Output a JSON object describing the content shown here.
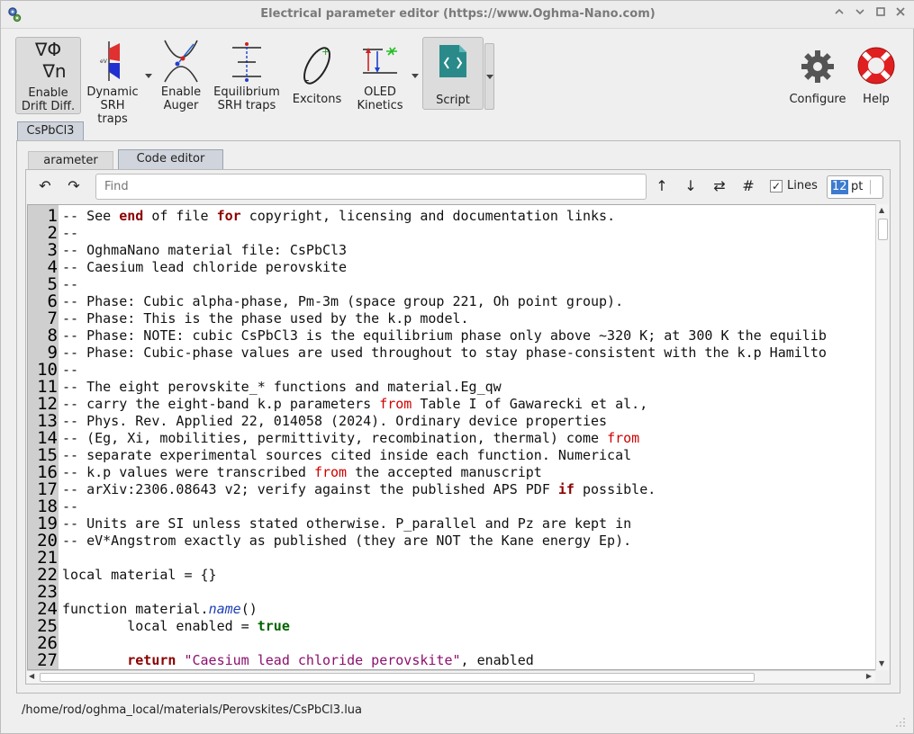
{
  "window": {
    "title": "Electrical parameter editor (https://www.Oghma-Nano.com)",
    "controls": [
      "minimize",
      "maximize",
      "restore",
      "close"
    ]
  },
  "toolbar": {
    "drift_diff_label1": "Enable",
    "drift_diff_label2": "Drift Diff.",
    "dynamic_srh_label1": "Dynamic",
    "dynamic_srh_label2": "SRH traps",
    "auger_label1": "Enable",
    "auger_label2": "Auger",
    "eq_srh_label1": "Equilibrium",
    "eq_srh_label2": "SRH traps",
    "excitons_label": "Excitons",
    "oled_label1": "OLED",
    "oled_label2": "Kinetics",
    "script_label": "Script",
    "configure_label": "Configure",
    "help_label": "Help",
    "drift_icon_line1": "∇Φ",
    "drift_icon_line2": "∇n"
  },
  "tabs": {
    "material": "CsPbCl3",
    "parameter": "arameter",
    "code_editor": "Code editor"
  },
  "editor_toolbar": {
    "undo": "↶",
    "redo": "↷",
    "find_placeholder": "Find",
    "up": "↑",
    "down": "↓",
    "replace": "⇄",
    "hash": "#",
    "lines_label": "Lines",
    "lines_checked": true,
    "font_size": "12",
    "font_unit": "pt"
  },
  "code": {
    "line_numbers": [
      "1",
      "2",
      "3",
      "4",
      "5",
      "6",
      "7",
      "8",
      "9",
      "10",
      "11",
      "12",
      "13",
      "14",
      "15",
      "16",
      "17",
      "18",
      "19",
      "20",
      "21",
      "22",
      "23",
      "24",
      "25",
      "26",
      "27"
    ],
    "lines": [
      "-- See end of file for copyright, licensing and documentation links.",
      "--",
      "-- OghmaNano material file: CsPbCl3",
      "-- Caesium lead chloride perovskite",
      "--",
      "-- Phase: Cubic alpha-phase, Pm-3m (space group 221, Oh point group).",
      "-- Phase: This is the phase used by the k.p model.",
      "-- Phase: NOTE: cubic CsPbCl3 is the equilibrium phase only above ~320 K; at 300 K the equilib",
      "-- Phase: Cubic-phase values are used throughout to stay phase-consistent with the k.p Hamilto",
      "--",
      "-- The eight perovskite_* functions and material.Eg_qw",
      "-- carry the eight-band k.p parameters from Table I of Gawarecki et al.,",
      "-- Phys. Rev. Applied 22, 014058 (2024). Ordinary device properties",
      "-- (Eg, Xi, mobilities, permittivity, recombination, thermal) come from",
      "-- separate experimental sources cited inside each function. Numerical",
      "-- k.p values were transcribed from the accepted manuscript",
      "-- arXiv:2306.08643 v2; verify against the published APS PDF if possible.",
      "--",
      "-- Units are SI unless stated otherwise. P_parallel and Pz are kept in",
      "-- eV*Angstrom exactly as published (they are NOT the Kane energy Ep).",
      "",
      "local material = {}",
      "",
      "function material.name()",
      "        local enabled = true",
      "",
      "        return \"Caesium lead chloride perovskite\", enabled"
    ]
  },
  "status": {
    "path": "/home/rod/oghma_local/materials/Perovskites/CsPbCl3.lua"
  },
  "colors": {
    "keyword": "#8b0000",
    "keyword_green": "#006400",
    "from_keyword": "#d00000",
    "function_name": "#1e3fb5",
    "string": "#8b0f6d",
    "selection": "#3d7bd0"
  }
}
